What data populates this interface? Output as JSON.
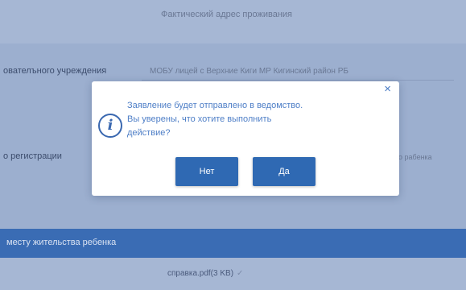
{
  "background": {
    "top_field_text": "Фактический адрес проживания",
    "institution_label": "ователъного учреждения",
    "institution_value": "МОБУ лицей с Верхние Киги МР Кигинский район РБ",
    "registration_label": "о регистрации",
    "registration_value": "о рабенка",
    "blue_band_title": "месту жительства ребенка",
    "file_name": "справка.pdf(3 KB)",
    "file_check": "✓"
  },
  "dialog": {
    "close_glyph": "×",
    "info_glyph": "i",
    "message_line1": "Заявление будет отправлено в ведомство.",
    "message_line2": "Вы уверены, что хотите выполнить",
    "message_line3": "действие?",
    "no_label": "Нет",
    "yes_label": "Да"
  },
  "colors": {
    "accent": "#2f69b3",
    "message_text": "#4f7fc7",
    "band_blue": "#3a6cb4"
  }
}
